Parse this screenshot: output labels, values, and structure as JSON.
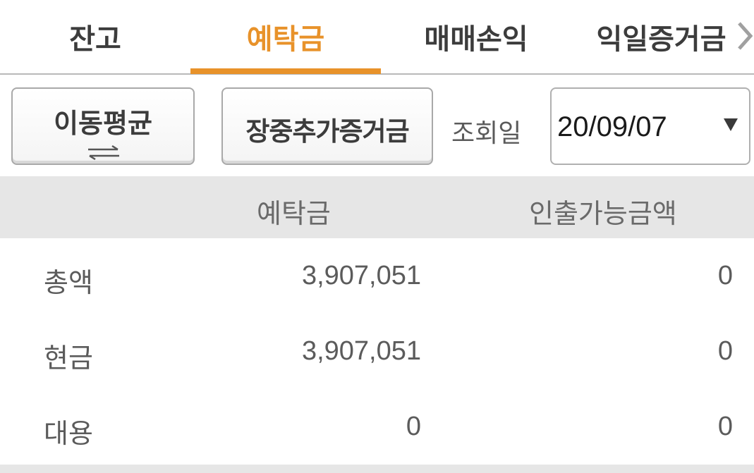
{
  "tabs": [
    {
      "label": "잔고",
      "active": false
    },
    {
      "label": "예탁금",
      "active": true
    },
    {
      "label": "매매손익",
      "active": false
    },
    {
      "label": "익일증거금",
      "active": false
    }
  ],
  "controls": {
    "moving_average_label": "이동평균",
    "additional_margin_label": "장중추가증거금",
    "query_date_label": "조회일",
    "query_date_value": "20/09/07"
  },
  "table": {
    "headers": [
      "예탁금",
      "인출가능금액"
    ],
    "rows": [
      {
        "label": "총액",
        "deposit": "3,907,051",
        "withdrawable": "0"
      },
      {
        "label": "현금",
        "deposit": "3,907,051",
        "withdrawable": "0"
      },
      {
        "label": "대용",
        "deposit": "0",
        "withdrawable": "0"
      }
    ]
  },
  "colors": {
    "accent": "#e8922a",
    "header_bg": "#e6e6e6",
    "text": "#5b5b5b"
  },
  "icons": [
    "swap-arrows-icon",
    "chevron-right-icon",
    "dropdown-arrow-icon"
  ]
}
